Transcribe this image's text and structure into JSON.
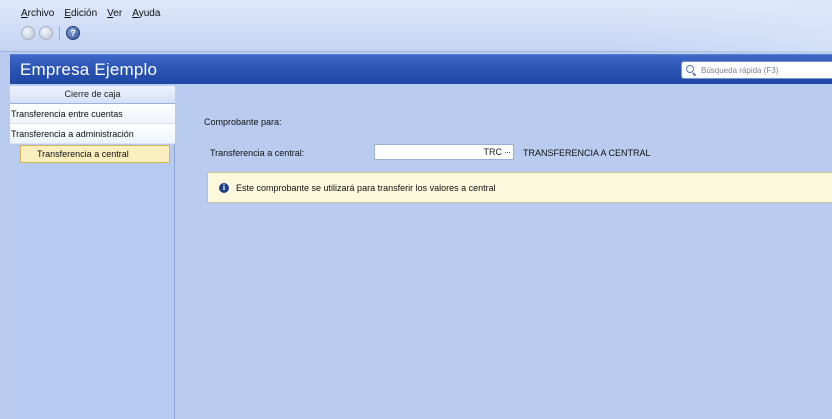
{
  "menu": [
    "Archivo",
    "Edición",
    "Ver",
    "Ayuda"
  ],
  "toolbar": {
    "buttons": [
      "back-icon",
      "forward-icon",
      "help-icon"
    ],
    "help_glyph": "?"
  },
  "title": "Empresa Ejemplo",
  "search": {
    "placeholder": "Búsqueda rápida (F3)"
  },
  "sidebar": {
    "header": "Cierre de caja",
    "items": [
      {
        "label": "Transferencia entre cuentas",
        "selected": false
      },
      {
        "label": "Transferencia a administración",
        "selected": false
      },
      {
        "label": "Transferencia a central",
        "selected": true
      }
    ]
  },
  "main": {
    "section_label": "Comprobante para:",
    "field_label": "Transferencia a central:",
    "field_value": "TRC",
    "ellipsis": "···",
    "field_description": "TRANSFERENCIA A CENTRAL",
    "info_glyph": "i",
    "info_text": "Este comprobante se utilizará para transferir los valores a central"
  },
  "colors": {
    "title_bar": "#2a53b4",
    "background": "#b9ccf0",
    "selected_item": "#fbefbf",
    "info_box": "#fbf8dc"
  }
}
